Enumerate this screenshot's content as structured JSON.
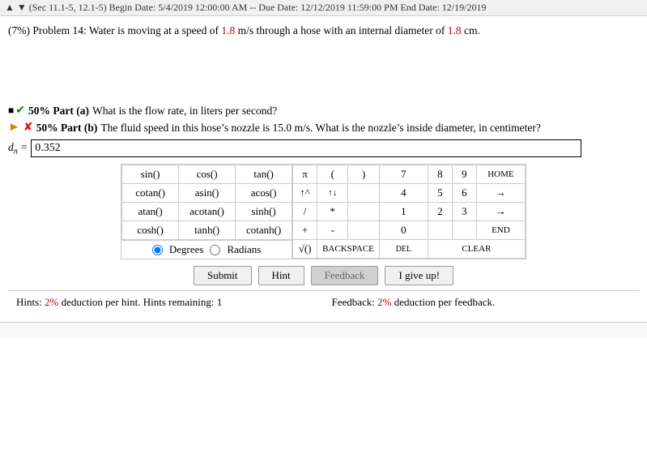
{
  "topbar": {
    "text": "▲ ▼ (Sec 11.1-5, 12.1-5) Begin Date: 5/4/2019 12:00:00 AM -- Due Date: 12/12/2019 11:59:00 PM End Date: 12/19/2019"
  },
  "problem": {
    "number": "(7%) Problem 14:",
    "text": " Water is moving at a speed of ",
    "speed": "1.8",
    "unit_speed": " m/s through a hose with an internal diameter of ",
    "diameter": "1.8",
    "unit_diameter": " cm."
  },
  "parts": {
    "a": {
      "percent": "50% Part (a)",
      "text": " What is the flow rate, in liters per second?"
    },
    "b": {
      "percent": "50% Part (b)",
      "text": " The fluid speed in this hose’s nozzle is 15.0 m/s. What is the nozzle’s inside diameter, in centimeter?"
    }
  },
  "answer": {
    "label": "d",
    "subscript": "n",
    "equals": " = ",
    "value": "0.352"
  },
  "keypad": {
    "left_buttons": [
      [
        "sin()",
        "cos()",
        "tan()"
      ],
      [
        "cotan()",
        "asin()",
        "acos()"
      ],
      [
        "atan()",
        "acotan()",
        "sinh()"
      ],
      [
        "cosh()",
        "tanh()",
        "cotanh()"
      ]
    ],
    "degrees_label": "Degrees",
    "radians_label": "Radians",
    "right_buttons": [
      [
        "π",
        "(",
        ")",
        "7",
        "8",
        "9",
        "HOME"
      ],
      [
        "↑^",
        "↑↓",
        "4",
        "5",
        "6",
        "→"
      ],
      [
        "/",
        "*",
        "1",
        "2",
        "3",
        "→"
      ],
      [
        "+",
        "-",
        "",
        "0",
        "",
        "END"
      ],
      [
        "√()",
        "BACKSPACE",
        "DEL",
        "CLEAR"
      ]
    ]
  },
  "buttons": {
    "submit": "Submit",
    "hint": "Hint",
    "feedback": "Feedback",
    "igiveup": "I give up!"
  },
  "hints": {
    "left": "Hints: ",
    "left_link": "2%",
    "left_rest": " deduction per hint. Hints remaining: ",
    "remaining": "1",
    "right": "Feedback: ",
    "right_link": "2%",
    "right_rest": " deduction per feedback."
  }
}
